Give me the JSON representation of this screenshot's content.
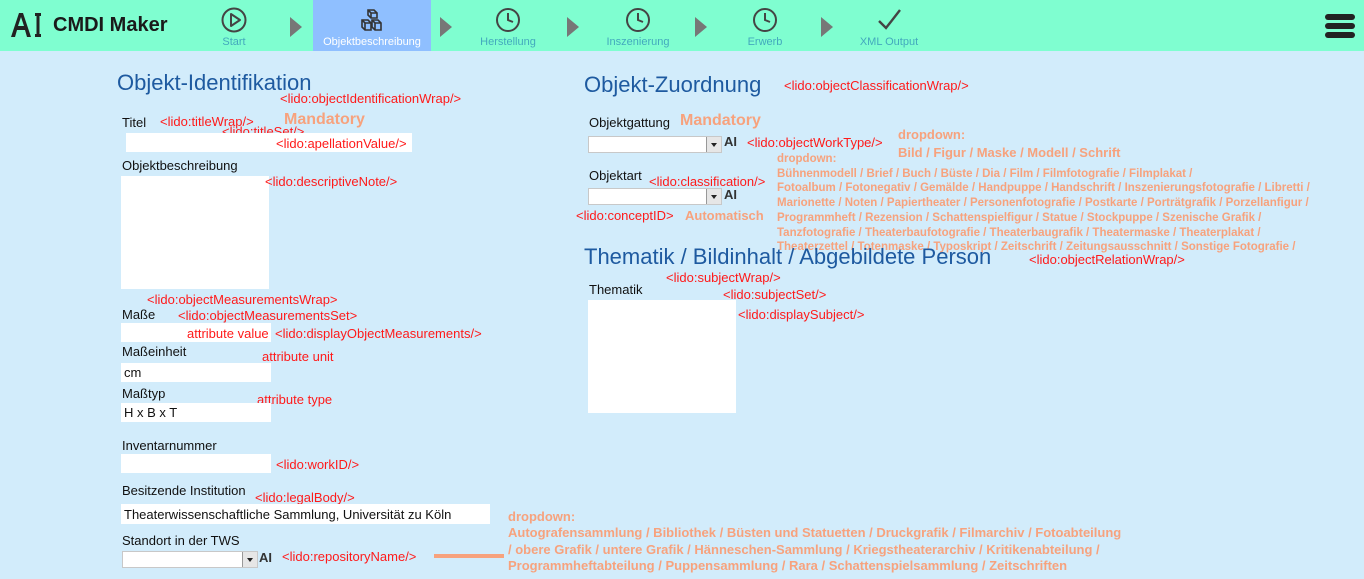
{
  "app": {
    "title": "CMDI Maker",
    "logo": "AI"
  },
  "steps": [
    {
      "label": "Start",
      "icon": "play-circle-icon"
    },
    {
      "label": "Objektbeschreibung",
      "icon": "cubes-icon",
      "active": true
    },
    {
      "label": "Herstellung",
      "icon": "clock-icon"
    },
    {
      "label": "Inszenierung",
      "icon": "clock-icon"
    },
    {
      "label": "Erwerb",
      "icon": "clock-icon"
    },
    {
      "label": "XML Output",
      "icon": "checkmark-icon"
    }
  ],
  "colors": {
    "topbar": "#7ffed0",
    "active_step": "#8fbfff",
    "background": "#d2ecfb",
    "heading": "#1e5aa0",
    "tag": "#ff1a1a",
    "note": "#f7a27d"
  },
  "left": {
    "heading": "Objekt-Identifikation",
    "wrap_tag": "<lido:objectIdentificationWrap/>",
    "title_label": "Titel",
    "title_wrap_tag": "<lido:titleWrap/>",
    "mandatory": "Mandatory",
    "title_set_tag": "<lido:titleSet/>",
    "apellation_tag": "<lido:apellationValue/>",
    "title_value": "",
    "desc_label": "Objektbeschreibung",
    "desc_tag": "<lido:descriptiveNote/>",
    "measure_wrap_tag": "<lido:objectMeasurementsWrap>",
    "measure_label": "Maße",
    "measure_set_tag": "<lido:objectMeasurementsSet>",
    "attr_value": "attribute value",
    "display_measure_tag": "<lido:displayObjectMeasurements/>",
    "unit_label": "Maßeinheit",
    "attr_unit": "attribute unit",
    "unit_value": "cm",
    "type_label": "Maßtyp",
    "attr_type": "attribute type",
    "type_value": "H x B x T",
    "inv_label": "Inventarnummer",
    "inv_value": "",
    "work_id_tag": "<lido:workID/>",
    "owner_label": "Besitzende Institution",
    "legal_body_tag": "<lido:legalBody/>",
    "owner_value": "Theaterwissenschaftliche Sammlung, Universität zu Köln",
    "location_label": "Standort in der TWS",
    "ai_glyph": "AI",
    "repository_tag": "<lido:repositoryName/>",
    "location_dropdown_title": "dropdown:",
    "location_options_1": "Autografensammlung / Bibliothek / Büsten und Statuetten / Druckgrafik / Filmarchiv / Fotoabteilung",
    "location_options_2": "/ obere Grafik / untere Grafik / Hänneschen-Sammlung / Kriegstheaterarchiv / Kritikenabteilung /",
    "location_options_3": "Programmheftabteilung / Puppensammlung / Rara / Schattenspielsammlung / Zeitschriften"
  },
  "right": {
    "heading": "Objekt-Zuordnung",
    "wrap_tag": "<lido:objectClassificationWrap/>",
    "gattung_label": "Objektgattung",
    "mandatory": "Mandatory",
    "ai_glyph": "AI",
    "work_type_tag": "<lido:objectWorkType/>",
    "gattung_dropdown_title": "dropdown:",
    "gattung_options": "Bild / Figur / Maske / Modell / Schrift",
    "art_label": "Objektart",
    "classification_tag": "<lido:classification/>",
    "concept_tag": "<lido:conceptID>",
    "automatic": "Automatisch",
    "art_dropdown_title": "dropdown:",
    "art_options_1": "Bühnenmodell / Brief / Buch / Büste / Dia / Film / Filmfotografie / Filmplakat /",
    "art_options_2": "Fotoalbum / Fotonegativ / Gemälde / Handpuppe / Handschrift / Inszenierungsfotografie / Libretti /",
    "art_options_3": "Marionette / Noten / Papiertheater / Personenfotografie / Postkarte / Porträtgrafik / Porzellanfigur /",
    "art_options_4": "Programmheft / Rezension / Schattenspielfigur / Statue / Stockpuppe / Szenische Grafik /",
    "art_options_5": "Tanzfotografie / Theaterbaufotografie / Theaterbaugrafik / Theatermaske / Theaterplakat /",
    "art_options_6": "Theaterzettel / Totenmaske / Typoskript / Zeitschrift / Zeitungsausschnitt / Sonstige Fotografie /",
    "thematik_heading": "Thematik / Bildinhalt / Abgebildete Person",
    "relation_tag": "<lido:objectRelationWrap/>",
    "subject_wrap_tag": "<lido:subjectWrap/>",
    "thematik_label": "Thematik",
    "subject_set_tag": "<lido:subjectSet/>",
    "display_subject_tag": "<lido:displaySubject/>"
  }
}
